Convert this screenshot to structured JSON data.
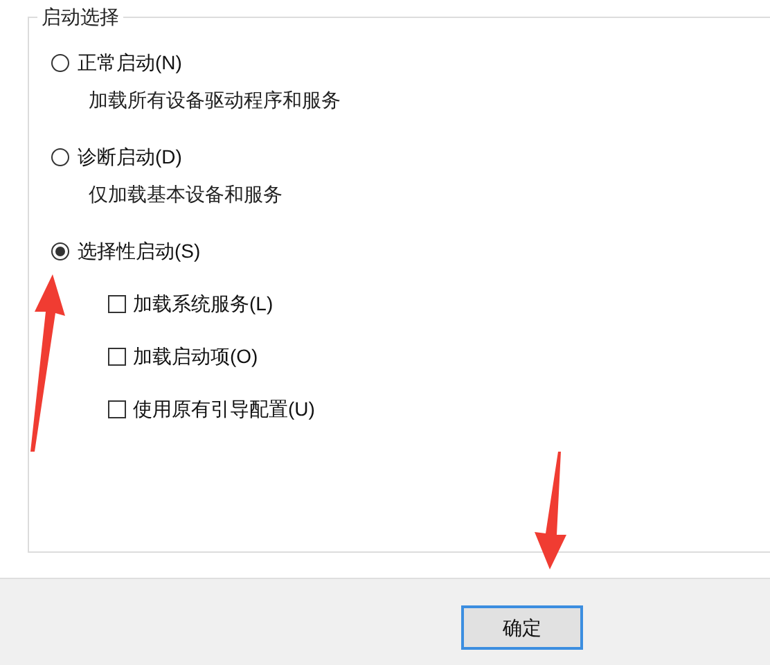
{
  "startup_selection": {
    "title": "启动选择",
    "options": [
      {
        "label": "正常启动(N)",
        "selected": false,
        "description": "加载所有设备驱动程序和服务"
      },
      {
        "label": "诊断启动(D)",
        "selected": false,
        "description": "仅加载基本设备和服务"
      },
      {
        "label": "选择性启动(S)",
        "selected": true,
        "checkboxes": [
          {
            "label": "加载系统服务(L)",
            "checked": false
          },
          {
            "label": "加载启动项(O)",
            "checked": false
          },
          {
            "label": "使用原有引导配置(U)",
            "checked": false
          }
        ]
      }
    ]
  },
  "buttons": [
    {
      "label": "确定"
    }
  ]
}
